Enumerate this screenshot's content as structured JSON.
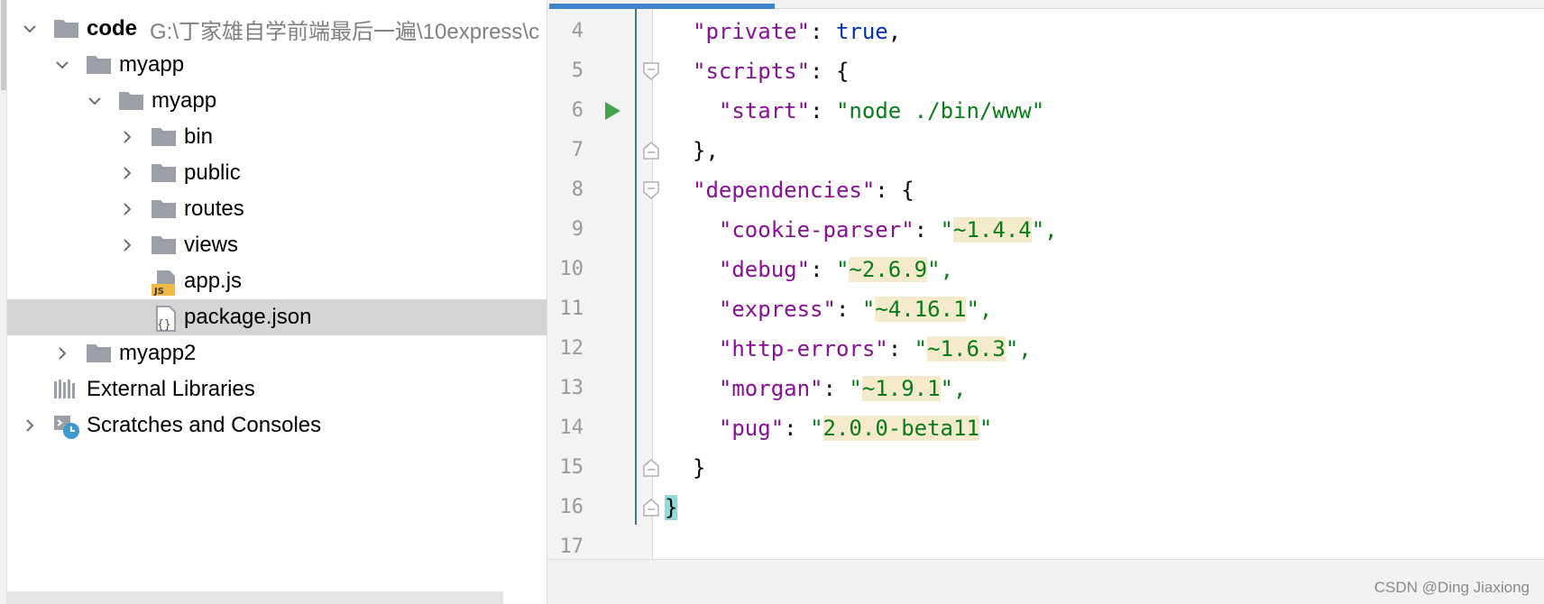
{
  "project_tree": {
    "root": {
      "label": "code",
      "path": "G:\\丁家雄自学前端最后一遍\\10express\\c"
    },
    "items": [
      {
        "label": "myapp"
      },
      {
        "label": "myapp"
      },
      {
        "label": "bin"
      },
      {
        "label": "public"
      },
      {
        "label": "routes"
      },
      {
        "label": "views"
      },
      {
        "label": "app.js",
        "icon": "javascript-file-icon"
      },
      {
        "label": "package.json",
        "icon": "json-file-icon",
        "selected": true
      },
      {
        "label": "myapp2"
      },
      {
        "label": "External Libraries",
        "icon": "library-icon"
      },
      {
        "label": "Scratches and Consoles",
        "icon": "scratches-icon"
      }
    ]
  },
  "editor": {
    "line_numbers": [
      "4",
      "5",
      "6",
      "7",
      "8",
      "9",
      "10",
      "11",
      "12",
      "13",
      "14",
      "15",
      "16",
      "17"
    ],
    "lines": [
      {
        "key": "\"private\"",
        "colon": ": ",
        "value": "true",
        "after": ","
      },
      {
        "key": "\"scripts\"",
        "colon": ": ",
        "open": "{"
      },
      {
        "key": "\"start\"",
        "colon": ": ",
        "value": "\"node ./bin/www\""
      },
      {
        "close": "},"
      },
      {
        "key": "\"dependencies\"",
        "colon": ": ",
        "open": "{"
      },
      {
        "key": "\"cookie-parser\"",
        "colon": ": ",
        "q": "\"",
        "value": "~1.4.4",
        "after": "\","
      },
      {
        "key": "\"debug\"",
        "colon": ": ",
        "q": "\"",
        "value": "~2.6.9",
        "after": "\","
      },
      {
        "key": "\"express\"",
        "colon": ": ",
        "q": "\"",
        "value": "~4.16.1",
        "after": "\","
      },
      {
        "key": "\"http-errors\"",
        "colon": ": ",
        "q": "\"",
        "value": "~1.6.3",
        "after": "\","
      },
      {
        "key": "\"morgan\"",
        "colon": ": ",
        "q": "\"",
        "value": "~1.9.1",
        "after": "\","
      },
      {
        "key": "\"pug\"",
        "colon": ": ",
        "q": "\"",
        "value": "2.0.0-beta11",
        "after": "\""
      },
      {
        "close": "}"
      },
      {
        "close": "}"
      },
      {
        "close": ""
      }
    ]
  },
  "watermark": "CSDN @Ding Jiaxiong",
  "colors": {
    "json_key": "#871094",
    "json_string": "#067d17",
    "json_keyword": "#0033b3",
    "version_highlight": "#f5eacb",
    "brace_match": "#93d9d9",
    "selection": "#d5d5d5",
    "run_icon": "#3fa34d"
  }
}
